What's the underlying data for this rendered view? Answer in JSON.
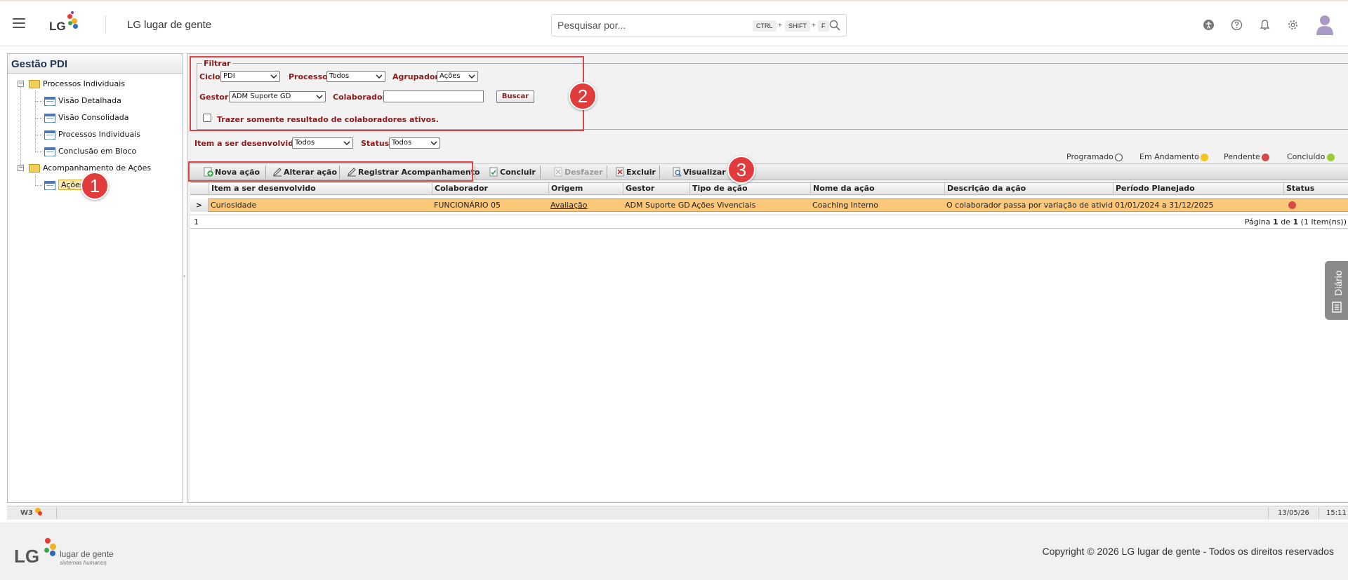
{
  "topbar": {
    "logo_text": "LG",
    "app_title": "LG lugar de gente",
    "search_placeholder": "Pesquisar por...",
    "shortcut_keys": [
      "CTRL",
      "SHIFT",
      "F"
    ],
    "shortcut_plus": "+"
  },
  "sidebar": {
    "title": "Gestão PDI",
    "items": [
      {
        "label": "Processos Individuais",
        "type": "folder",
        "level": 0,
        "expanded": true
      },
      {
        "label": "Visão Detalhada",
        "type": "page",
        "level": 1
      },
      {
        "label": "Visão Consolidada",
        "type": "page",
        "level": 1
      },
      {
        "label": "Processos Individuais",
        "type": "page",
        "level": 1
      },
      {
        "label": "Conclusão em Bloco",
        "type": "page",
        "level": 1
      },
      {
        "label": "Acompanhamento de Ações",
        "type": "folder",
        "level": 0,
        "expanded": true
      },
      {
        "label": "Ações",
        "type": "page",
        "level": 1,
        "selected": true
      }
    ]
  },
  "filter": {
    "legend": "Filtrar",
    "ciclo_label": "Ciclo",
    "ciclo_value": "PDI",
    "processo_label": "Processo",
    "processo_value": "Todos",
    "agrupador_label": "Agrupador",
    "agrupador_value": "Ações",
    "gestor_label": "Gestor",
    "gestor_value": "ADM Suporte GD",
    "colaborador_label": "Colaborador",
    "colaborador_value": "",
    "buscar_label": "Buscar",
    "ativos_label": "Trazer somente resultado de colaboradores ativos.",
    "ativos_checked": false
  },
  "subfilter": {
    "item_label": "Item a ser desenvolvido",
    "item_value": "Todos",
    "status_label": "Status",
    "status_value": "Todos"
  },
  "legend": {
    "items": [
      {
        "label": "Programado",
        "color": "#ffffff"
      },
      {
        "label": "Em Andamento",
        "color": "#f6c21c"
      },
      {
        "label": "Pendente",
        "color": "#d84a4a"
      },
      {
        "label": "Concluído",
        "color": "#9acd32"
      }
    ]
  },
  "toolbar": {
    "nova_acao": "Nova ação",
    "alterar_acao": "Alterar ação",
    "registrar": "Registrar Acompanhamento",
    "concluir": "Concluir",
    "desfazer": "Desfazer",
    "excluir": "Excluir",
    "visualizar": "Visualizar"
  },
  "grid": {
    "columns": [
      "Item a ser desenvolvido",
      "Colaborador",
      "Origem",
      "Gestor",
      "Tipo de ação",
      "Nome da ação",
      "Descrição da ação",
      "Período Planejado",
      "Status"
    ],
    "rows": [
      {
        "item": "Curiosidade",
        "colaborador": "FUNCIONÁRIO 05",
        "origem": "Avaliação",
        "gestor": "ADM Suporte GD",
        "tipo": "Ações Vivenciais",
        "nome": "Coaching Interno",
        "descricao": "O colaborador passa por variação de ativida...",
        "periodo": "01/01/2024 a 31/12/2025",
        "status": "Pendente"
      }
    ],
    "row_indicator": ">",
    "page_number": "1",
    "pagination": {
      "prefix": "Página",
      "current": "1",
      "of": "de",
      "total": "1",
      "items": "(1 Item(ns))"
    }
  },
  "callouts": [
    "1",
    "2",
    "3"
  ],
  "side_tab": {
    "label": "Diário"
  },
  "statusbar": {
    "logo": "W3",
    "date": "13/05/26",
    "time": "15:11"
  },
  "footer": {
    "logo_text": "LG",
    "brand_line1": "lugar de gente",
    "brand_line2": "sistemas humanos",
    "copyright": "Copyright © 2026 LG lugar de gente - Todos os direitos reservados"
  }
}
